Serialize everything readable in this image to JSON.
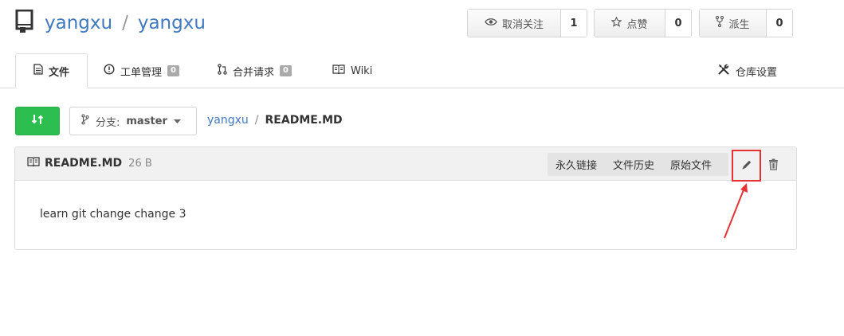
{
  "repo": {
    "owner": "yangxu",
    "separator": "/",
    "name": "yangxu"
  },
  "actions": {
    "watch": {
      "label": "取消关注",
      "count": "1"
    },
    "star": {
      "label": "点赞",
      "count": "0"
    },
    "fork": {
      "label": "派生",
      "count": "0"
    }
  },
  "tabs": [
    {
      "label": "文件",
      "icon": "file-icon",
      "active": true
    },
    {
      "label": "工单管理",
      "icon": "issue-icon",
      "badge": "0"
    },
    {
      "label": "合并请求",
      "icon": "pull-request-icon",
      "badge": "0"
    },
    {
      "label": "Wiki",
      "icon": "book-icon"
    },
    {
      "label": "仓库设置",
      "icon": "tools-icon"
    }
  ],
  "branch": {
    "prefix": "分支:",
    "name": "master"
  },
  "breadcrumb": {
    "root": "yangxu",
    "separator": "/",
    "current": "README.MD"
  },
  "file": {
    "name": "README.MD",
    "size": "26 B",
    "actions": [
      "永久链接",
      "文件历史",
      "原始文件"
    ],
    "content": "learn git change change 3"
  },
  "colors": {
    "link": "#4078c0",
    "sync_button": "#2cbe4e",
    "highlight": "#e53333"
  }
}
